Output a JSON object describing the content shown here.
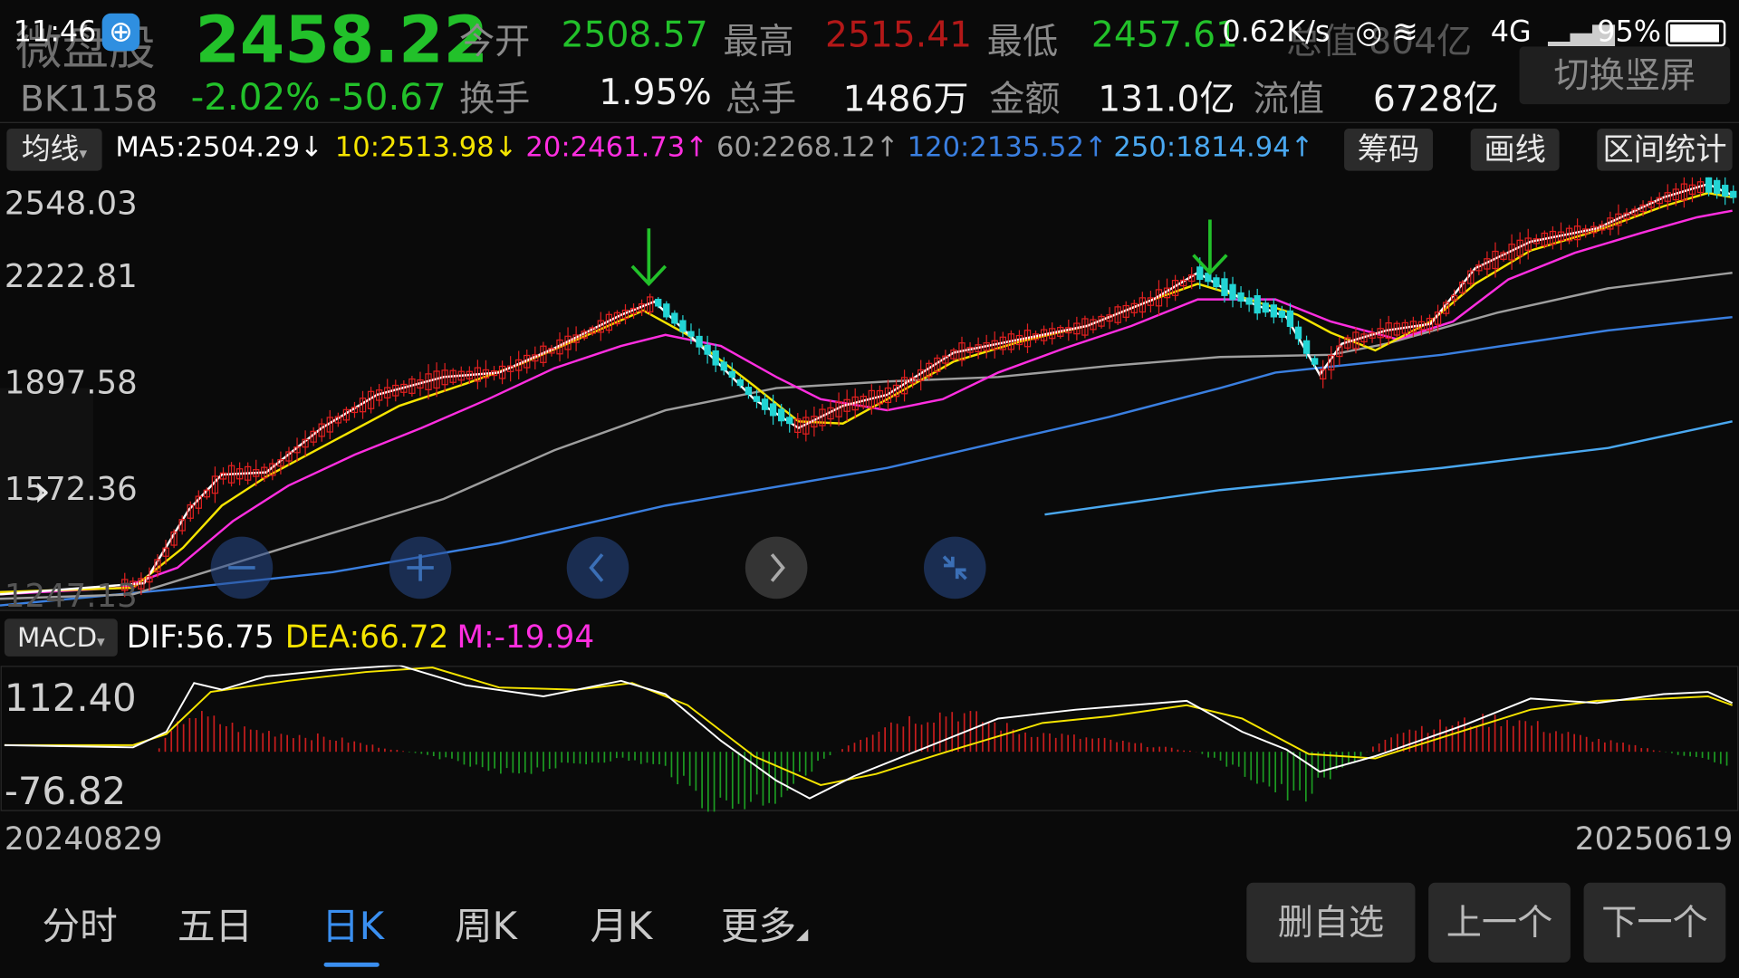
{
  "status_bar": {
    "time": "11:46",
    "net_speed": "0.62K/s",
    "network": "4G",
    "battery": "95%",
    "partial_text": "总值 804亿"
  },
  "header": {
    "name": "微盘股",
    "code": "BK1158",
    "price": "2458.22",
    "change_pct": "-2.02%",
    "change_abs": "-50.67",
    "open_label": "今开",
    "open_value": "2508.57",
    "high_label": "最高",
    "high_value": "2515.41",
    "low_label": "最低",
    "low_value": "2457.61",
    "turnover_label": "换手",
    "turnover_value": "1.95%",
    "volume_label": "总手",
    "volume_value": "1486万",
    "amount_label": "金额",
    "amount_value": "131.0亿",
    "float_label": "流值",
    "float_value": "6728亿",
    "switch_label": "切换竖屏"
  },
  "ma_bar": {
    "selector": "均线",
    "ma5": "MA5:2504.29↓",
    "ma10": "10:2513.98↓",
    "ma20": "20:2461.73↑",
    "ma60": "60:2268.12↑",
    "ma120": "120:2135.52↑",
    "ma250": "250:1814.94↑",
    "btn_chip": "筹码",
    "btn_draw": "画线",
    "btn_stat": "区间统计"
  },
  "price_axis": {
    "t1": "2548.03",
    "t2": "2222.81",
    "t3": "1897.58",
    "t4": "1572.36",
    "t5": "1247.13"
  },
  "macd": {
    "selector": "MACD",
    "dif": "DIF:56.75",
    "dea": "DEA:66.72",
    "m": "M:-19.94",
    "t_high": "112.40",
    "t_low": "-76.82"
  },
  "dates": {
    "start": "20240829",
    "end": "20250619"
  },
  "tabs": {
    "t1": "分时",
    "t2": "五日",
    "t3": "日K",
    "t4": "周K",
    "t5": "月K",
    "t6": "更多"
  },
  "actions": {
    "remove": "删自选",
    "prev": "上一个",
    "next": "下一个"
  },
  "colors": {
    "up": "#e02020",
    "down": "#22c12a",
    "ma5": "#ffffff",
    "ma10": "#f5e400",
    "ma20": "#ff2ee0",
    "ma60": "#9e9e9e",
    "ma120": "#3a7fe0",
    "ma250": "#4aa8f0"
  }
}
